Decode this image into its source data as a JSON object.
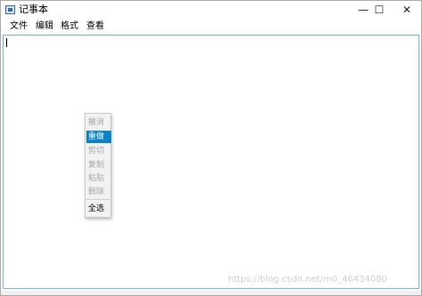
{
  "window": {
    "title": "记事本",
    "minimize_glyph": "—",
    "maximize_glyph": "☐",
    "close_glyph": "✕"
  },
  "menubar": {
    "items": [
      {
        "label": "文件"
      },
      {
        "label": "编辑"
      },
      {
        "label": "格式"
      },
      {
        "label": "查看"
      }
    ]
  },
  "context_menu": {
    "items": [
      {
        "label": "撤消",
        "enabled": false
      },
      {
        "label": "重做",
        "enabled": true,
        "highlighted": true
      },
      {
        "label": "剪切",
        "enabled": false
      },
      {
        "label": "复制",
        "enabled": false
      },
      {
        "label": "粘贴",
        "enabled": false
      },
      {
        "label": "删除",
        "enabled": false
      },
      {
        "label": "全选",
        "enabled": true
      }
    ]
  },
  "watermark": "https://blog.csdn.net/m0_46434080",
  "colors": {
    "highlight": "#0a84c9",
    "editor_border": "#6fb7e0",
    "disabled_text": "#a6a6a6"
  }
}
